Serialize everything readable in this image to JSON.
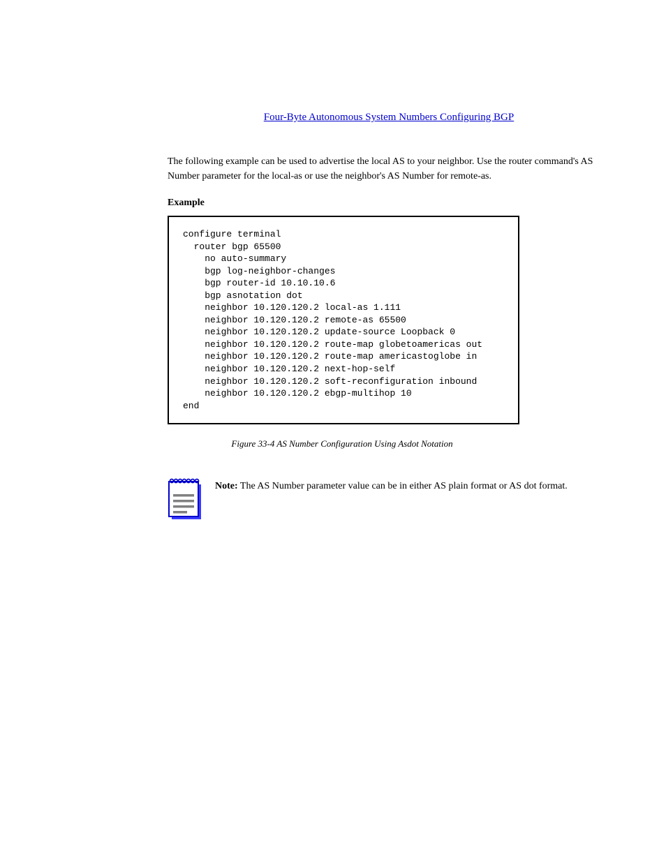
{
  "header": {
    "linkText": "Four-Byte Autonomous System Numbers  Configuring BGP"
  },
  "content": {
    "paragraph1": "The following example can be used to advertise the local AS to your neighbor. Use the router command's AS Number parameter for the local-as or use the neighbor's AS Number for remote-as.",
    "subheading1": "Example",
    "codeLines": [
      "configure terminal",
      "  router bgp 65500",
      "    no auto-summary",
      "    bgp log-neighbor-changes",
      "    bgp router-id 10.10.10.6",
      "    bgp asnotation dot",
      "    neighbor 10.120.120.2 local-as 1.111",
      "    neighbor 10.120.120.2 remote-as 65500",
      "    neighbor 10.120.120.2 update-source Loopback 0",
      "    neighbor 10.120.120.2 route-map globetoamericas out",
      "    neighbor 10.120.120.2 route-map americastoglobe in",
      "    neighbor 10.120.120.2 next-hop-self",
      "    neighbor 10.120.120.2 soft-reconfiguration inbound",
      "    neighbor 10.120.120.2 ebgp-multihop 10",
      "end"
    ],
    "figureCaption": "Figure 33-4   AS Number Configuration Using Asdot Notation",
    "note": {
      "label": "Note:",
      "text": " The AS Number parameter value can be in either AS plain format or AS dot format."
    }
  }
}
